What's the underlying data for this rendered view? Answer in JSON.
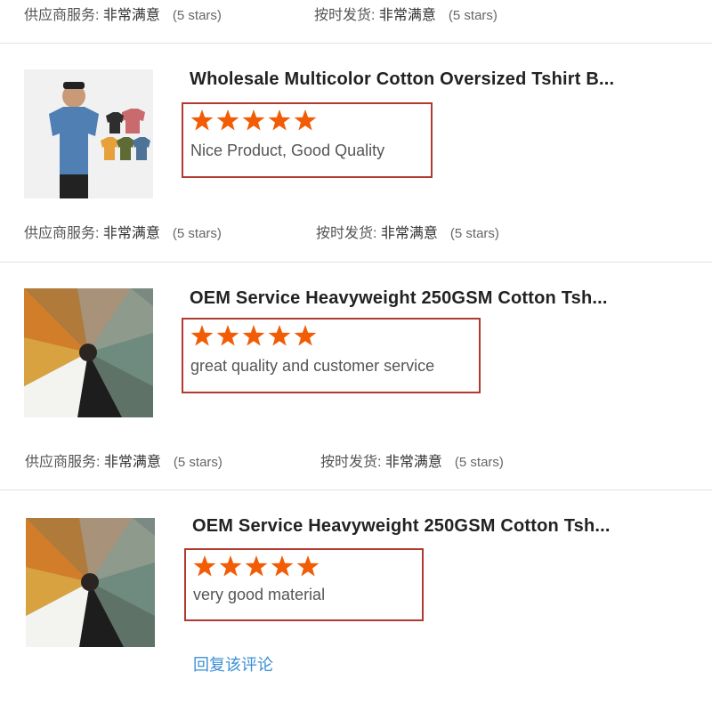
{
  "meta_rows": [
    {
      "service_label": "供应商服务:",
      "service_value": "非常满意",
      "service_stars": "(5 stars)",
      "ship_label": "按时发货:",
      "ship_value": "非常满意",
      "ship_stars": "(5 stars)"
    },
    {
      "service_label": "供应商服务:",
      "service_value": "非常满意",
      "service_stars": "(5 stars)",
      "ship_label": "按时发货:",
      "ship_value": "非常满意",
      "ship_stars": "(5 stars)"
    },
    {
      "service_label": "供应商服务:",
      "service_value": "非常满意",
      "service_stars": "(5 stars)",
      "ship_label": "按时发货:",
      "ship_value": "非常满意",
      "ship_stars": "(5 stars)"
    }
  ],
  "reviews": [
    {
      "title": "Wholesale Multicolor Cotton Oversized Tshirt B...",
      "rating": 5,
      "text": "Nice Product, Good Quality"
    },
    {
      "title": "OEM Service Heavyweight 250GSM Cotton Tsh...",
      "rating": 5,
      "text": "great quality and customer service"
    },
    {
      "title": "OEM Service Heavyweight 250GSM Cotton Tsh...",
      "rating": 5,
      "text": "very good material"
    }
  ],
  "reply_link": "回复该评论",
  "colors": {
    "star": "#f25c05",
    "box_border": "#b03a30",
    "link": "#3a8fd6"
  }
}
